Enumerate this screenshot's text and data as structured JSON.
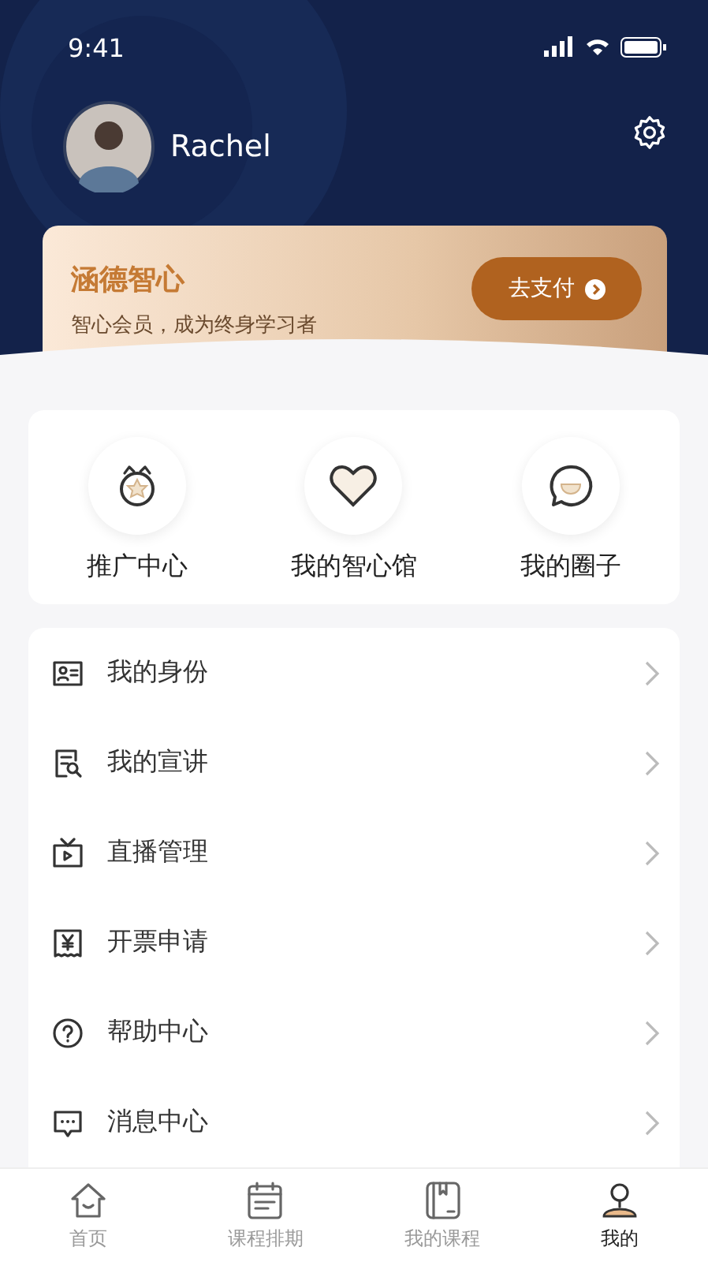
{
  "status_bar": {
    "time": "9:41"
  },
  "profile": {
    "name": "Rachel"
  },
  "membership": {
    "title": "涵德智心",
    "subtitle": "智心会员，成为终身学习者",
    "button": "去支付"
  },
  "shortcuts": [
    {
      "kind": "medal",
      "label": "推广中心"
    },
    {
      "kind": "heart",
      "label": "我的智心馆"
    },
    {
      "kind": "chat",
      "label": "我的圈子"
    }
  ],
  "menu": [
    {
      "kind": "id",
      "label": "我的身份"
    },
    {
      "kind": "doc",
      "label": "我的宣讲"
    },
    {
      "kind": "tv",
      "label": "直播管理"
    },
    {
      "kind": "invoice",
      "label": "开票申请"
    },
    {
      "kind": "help",
      "label": "帮助中心"
    },
    {
      "kind": "message",
      "label": "消息中心"
    }
  ],
  "tab_bar": [
    {
      "kind": "home",
      "label": "首页",
      "selected": false
    },
    {
      "kind": "calendar",
      "label": "课程排期",
      "selected": false
    },
    {
      "kind": "book",
      "label": "我的课程",
      "selected": false
    },
    {
      "kind": "me",
      "label": "我的",
      "selected": true
    }
  ]
}
